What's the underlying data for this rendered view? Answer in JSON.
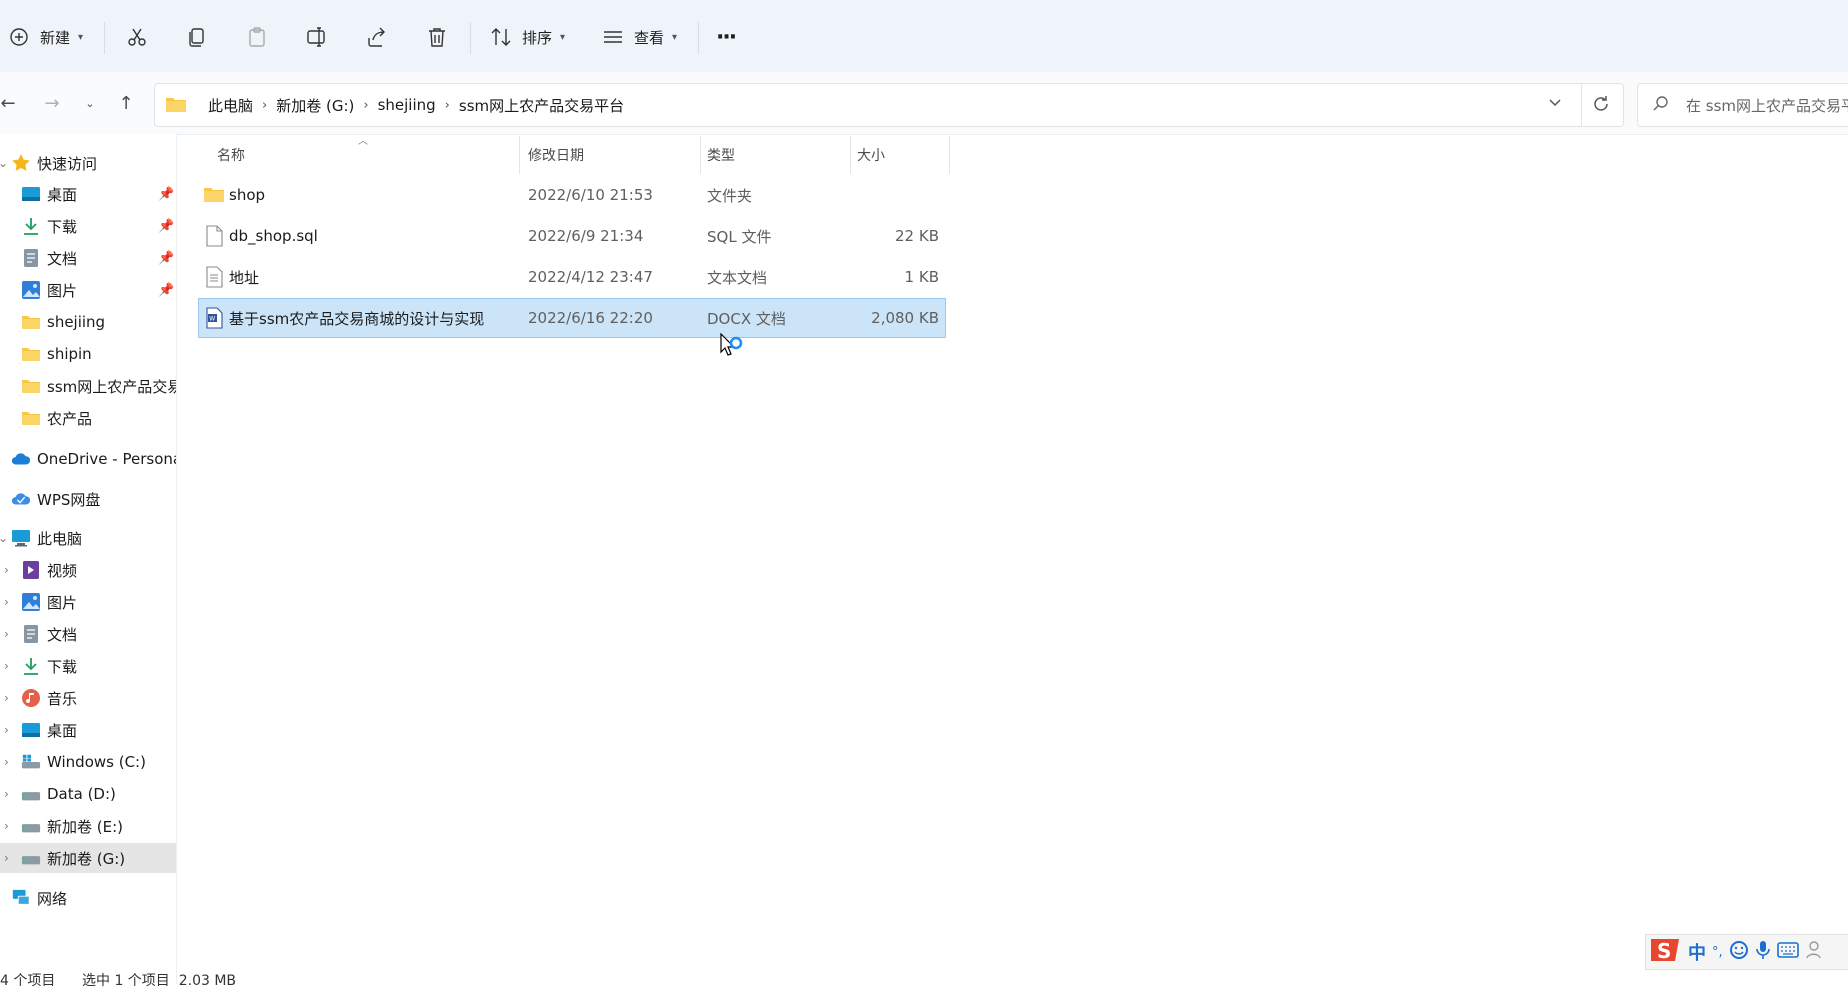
{
  "toolbar": {
    "new_label": "新建",
    "sort_label": "排序",
    "view_label": "查看",
    "more_label": "···"
  },
  "nav": {
    "breadcrumbs": [
      "此电脑",
      "新加卷 (G:)",
      "shejiing",
      "ssm网上农产品交易平台"
    ],
    "search_placeholder": "在 ssm网上农产品交易平台 中搜索"
  },
  "sidebar": {
    "quick_access": "快速访问",
    "quick_items": [
      "桌面",
      "下载",
      "文档",
      "图片",
      "shejiing",
      "shipin",
      "ssm网上农产品交易平台",
      "农产品"
    ],
    "onedrive": "OneDrive - Personal",
    "wps": "WPS网盘",
    "this_pc": "此电脑",
    "pc_items": [
      "视频",
      "图片",
      "文档",
      "下载",
      "音乐",
      "桌面",
      "Windows (C:)",
      "Data (D:)",
      "新加卷 (E:)",
      "新加卷 (G:)"
    ],
    "network": "网络"
  },
  "columns": {
    "name": "名称",
    "date": "修改日期",
    "type": "类型",
    "size": "大小"
  },
  "files": [
    {
      "name": "shop",
      "date": "2022/6/10 21:53",
      "type": "文件夹",
      "size": ""
    },
    {
      "name": "db_shop.sql",
      "date": "2022/6/9 21:34",
      "type": "SQL 文件",
      "size": "22 KB"
    },
    {
      "name": "地址",
      "date": "2022/4/12 23:47",
      "type": "文本文档",
      "size": "1 KB"
    },
    {
      "name": "基于ssm农产品交易商城的设计与实现",
      "date": "2022/6/16 22:20",
      "type": "DOCX 文档",
      "size": "2,080 KB"
    }
  ],
  "status": {
    "count": "4 个项目",
    "selected": "选中 1 个项目  2.03 MB"
  },
  "ime": {
    "lang": "中",
    "punct": "°,"
  },
  "colors": {
    "selection": "#cce4f7",
    "toolbar_bg": "#eef4f9",
    "folder": "#f8c745",
    "accent": "#0067c0"
  }
}
